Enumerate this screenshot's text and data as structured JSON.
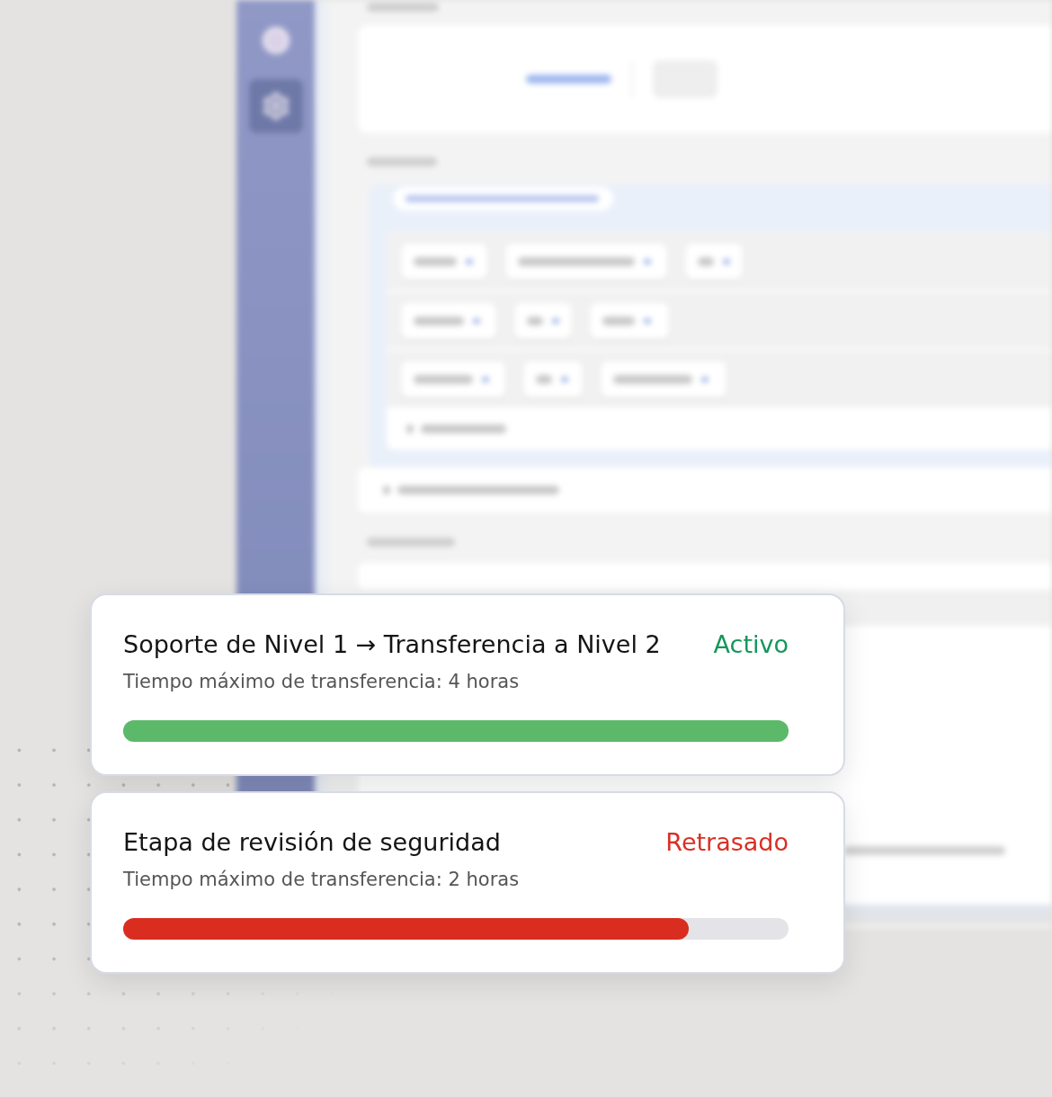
{
  "cards": [
    {
      "title": "Soporte de Nivel 1 → Transferencia a Nivel 2",
      "status": {
        "kind": "active",
        "label": "Activo"
      },
      "subtitle": "Tiempo máximo de transferencia: 4 horas",
      "level": 1
    },
    {
      "title": "Etapa de revisión de seguridad",
      "status": {
        "kind": "delayed",
        "label": "Retrasado"
      },
      "subtitle": "Tiempo máximo de transferencia: 2 horas",
      "level": 0.85
    }
  ]
}
